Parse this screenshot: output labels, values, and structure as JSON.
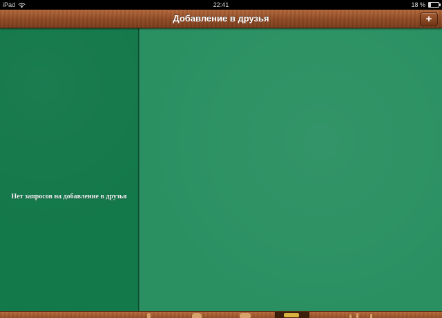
{
  "status_bar": {
    "device": "iPad",
    "time": "22:41",
    "battery": "18 %",
    "battery_level": 0.18
  },
  "nav_bar": {
    "title": "Добавление в друзья",
    "add_button_label": "+"
  },
  "left_pane": {
    "empty_message": "Нет запросов на добавление в друзья"
  },
  "tab_bar": {
    "items": [
      {
        "icon": "person-icon",
        "selected": false
      },
      {
        "icon": "hands-icon",
        "selected": false
      },
      {
        "icon": "dice-icon",
        "selected": false
      },
      {
        "icon": "game-board-icon",
        "selected": true
      },
      {
        "icon": "leaderboard-icon",
        "selected": false
      }
    ]
  },
  "colors": {
    "left_pane": "#13784a",
    "right_pane": "#2a9062",
    "wood": "#8e4a25"
  }
}
